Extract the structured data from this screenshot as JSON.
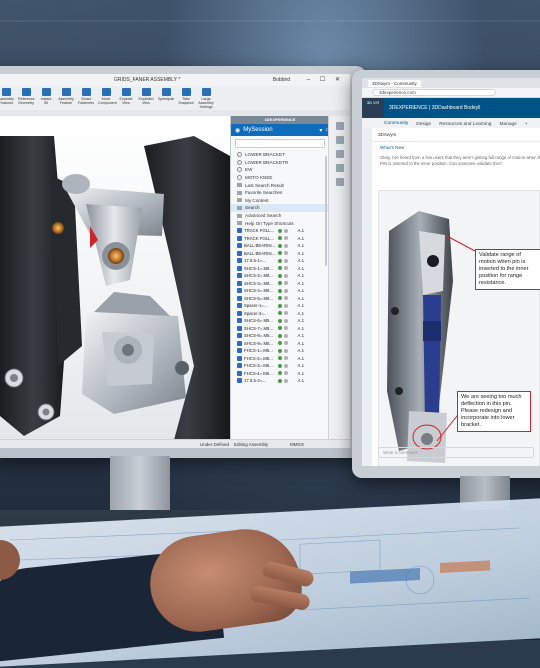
{
  "solidworks": {
    "title": "GRIDS_FANER ASSEMBLY *",
    "user": "Bobbird",
    "window_buttons": "– ☐ ✕",
    "ribbon": [
      {
        "label": "Assembly Features"
      },
      {
        "label": "Reference Geometry"
      },
      {
        "label": "Instant 3D"
      },
      {
        "label": "Assembly Feature"
      },
      {
        "label": "Smart Fasteners"
      },
      {
        "label": "Move Component"
      },
      {
        "label": "Explode View"
      },
      {
        "label": "Exploded View"
      },
      {
        "label": "Speedpak"
      },
      {
        "label": "Take Snapshot"
      },
      {
        "label": "Large Assembly Settings"
      }
    ],
    "status": {
      "left": "Under Defined",
      "middle": "Editing Assembly",
      "right": "MMGS"
    }
  },
  "task_pane": {
    "header": "3DEXPERIENCE",
    "session_label": "MySession",
    "search_placeholder": "",
    "menu": [
      "LOWER BRACKET",
      "LOWER BRACKETR",
      "EW",
      "MOTO KNEE",
      "Last Search Result",
      "Favorite Searches",
      "My Content",
      "Search",
      "Advanced Search",
      "Help On Type Shortcuts"
    ],
    "files": [
      {
        "name": "TRACK FOLL...",
        "rev": "A.1"
      },
      {
        "name": "TRACK FOLL...",
        "rev": "A.1"
      },
      {
        "name": "BALL BEARIN...",
        "rev": "A.1"
      },
      {
        "name": "BALL BEARIN...",
        "rev": "A.1"
      },
      {
        "name": "17.6.5-1=...",
        "rev": "A.1"
      },
      {
        "name": "SHCS-1=.M5...",
        "rev": "A.1"
      },
      {
        "name": "SHCS-2=.M5...",
        "rev": "A.1"
      },
      {
        "name": "SHCS-3=.M5...",
        "rev": "A.1"
      },
      {
        "name": "SHCS-4=.M5...",
        "rev": "A.1"
      },
      {
        "name": "SHCS-5=.M5...",
        "rev": "A.1"
      },
      {
        "name": "Spacer-1=...",
        "rev": "A.1"
      },
      {
        "name": "Spacer-2=...",
        "rev": "A.1"
      },
      {
        "name": "SHCS-6=.M5...",
        "rev": "A.1"
      },
      {
        "name": "SHCS-7=.M5...",
        "rev": "A.1"
      },
      {
        "name": "SHCS-8=.M5...",
        "rev": "A.1"
      },
      {
        "name": "SHCS-9=.M5...",
        "rev": "A.1"
      },
      {
        "name": "FHCS-1=.M5...",
        "rev": "A.1"
      },
      {
        "name": "FHCS-2=.M5...",
        "rev": "A.1"
      },
      {
        "name": "FHCS-3=.M5...",
        "rev": "A.1"
      },
      {
        "name": "FHCS-4=.M5...",
        "rev": "A.1"
      },
      {
        "name": "17.6.5-2=...",
        "rev": "A.1"
      }
    ]
  },
  "browser": {
    "tab": "3DSwym - Community",
    "url": "3dexperience.com"
  },
  "swym": {
    "app_title": "3DEXPERIENCE | 3DDashboard",
    "app_user": "Bodeyll",
    "logo": "3D V.R",
    "tabs": [
      "Community",
      "Design",
      "Resources and Learning",
      "Manage",
      "+"
    ],
    "active_tab": "Community",
    "breadcrumb": "3DSwym",
    "section": "What's New",
    "post_text": "Okay, I've heard from a few users that they aren't getting full range of motion when the PIN is inserted to the inner position. Can someone validate this?",
    "comment_placeholder": "Write a comment",
    "callout_1": "Validate range of motion when pin is inserted to the inner position for range resistance.",
    "callout_2": "We are seeing too much deflection in this pin. Please redesign and incorporate into lower bracket."
  }
}
